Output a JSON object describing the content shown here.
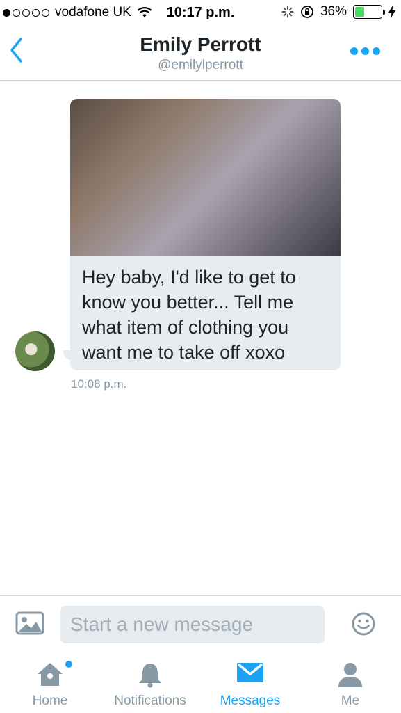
{
  "status_bar": {
    "carrier": "vodafone UK",
    "time": "10:17 p.m.",
    "battery": "36%",
    "battery_level": 0.36,
    "signal_bars_filled": 1,
    "signal_bars_total": 5
  },
  "header": {
    "name": "Emily Perrott",
    "handle": "@emilylperrott"
  },
  "conversation": {
    "message": {
      "text": "Hey baby, I'd like to get to know you better... Tell me what item of clothing you want me to take off xoxo",
      "timestamp": "10:08 p.m."
    }
  },
  "composer": {
    "placeholder": "Start a new message"
  },
  "tabs": [
    {
      "label": "Home",
      "icon": "home-icon"
    },
    {
      "label": "Notifications",
      "icon": "bell-icon"
    },
    {
      "label": "Messages",
      "icon": "envelope-icon",
      "active": true
    },
    {
      "label": "Me",
      "icon": "person-icon"
    }
  ],
  "colors": {
    "accent": "#1da1f2",
    "bubble": "#e6ecf0",
    "muted": "#8899a6",
    "battery": "#4cd964"
  }
}
